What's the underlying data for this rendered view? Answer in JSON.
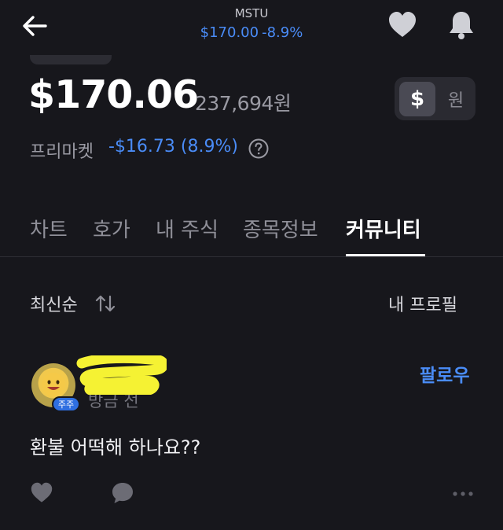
{
  "header": {
    "ticker": "MSTU",
    "price": "$170.00",
    "change": "-8.9%"
  },
  "quote": {
    "price_usd": "$170.06",
    "price_krw": "237,694원",
    "currency_toggle": {
      "usd": "$",
      "krw": "원",
      "selected": "usd"
    },
    "premarket_label": "프리마켓",
    "premarket_change": "-$16.73 (8.9%)"
  },
  "tabs": [
    {
      "label": "차트"
    },
    {
      "label": "호가"
    },
    {
      "label": "내 주식"
    },
    {
      "label": "종목정보"
    },
    {
      "label": "커뮤니티",
      "active": true
    }
  ],
  "community": {
    "sort_label": "최신순",
    "profile_link": "내 프로필"
  },
  "post": {
    "badge": "주주",
    "time": "방금 전",
    "follow": "팔로우",
    "body": "환불 어떡해 하나요??"
  },
  "colors": {
    "background": "#17171c",
    "accent_blue": "#4a8cf7",
    "redaction": "#f5f233"
  },
  "icons": {
    "back": "arrow-left-icon",
    "favorite": "heart-icon",
    "alerts": "bell-icon",
    "info": "question-circle-icon",
    "sort": "sort-arrows-icon",
    "like": "heart-icon",
    "comment": "speech-bubble-icon",
    "more": "more-dots-icon"
  }
}
